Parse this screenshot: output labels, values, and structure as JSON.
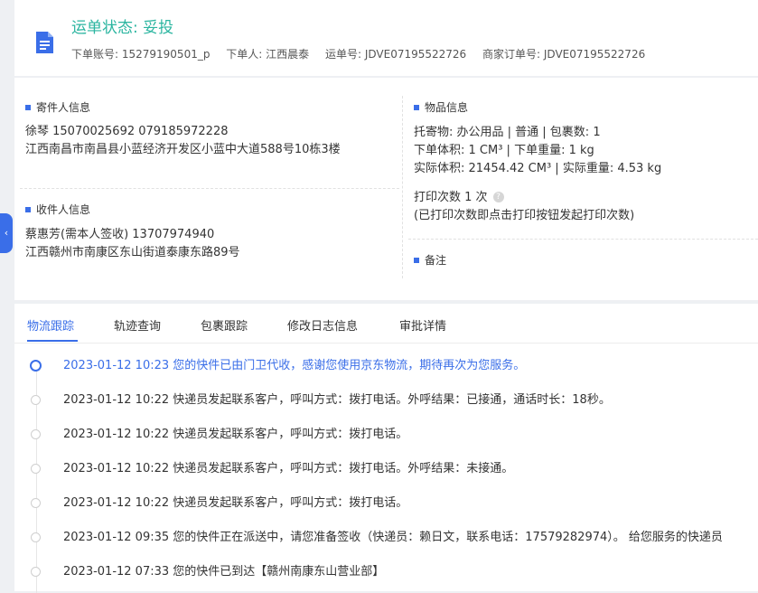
{
  "header": {
    "status": "运单状态: 妥投",
    "meta": [
      "下单账号: 15279190501_p",
      "下单人: 江西晨泰",
      "运单号: JDVE07195522726",
      "商家订单号: JDVE07195522726"
    ]
  },
  "sender": {
    "title": "寄件人信息",
    "line1": "徐琴  15070025692  079185972228",
    "line2": "江西南昌市南昌县小蓝经济开发区小蓝中大道588号10栋3楼"
  },
  "receiver": {
    "title": "收件人信息",
    "line1": "蔡惠芳(需本人签收)  13707974940",
    "line2": "江西赣州市南康区东山街道泰康东路89号"
  },
  "goods": {
    "title": "物品信息",
    "line1": "托寄物:  办公用品 | 普通 | 包裹数:  1",
    "line2": "下单体积:  1 CM³ | 下单重量:  1 kg",
    "line3": "实际体积:  21454.42 CM³ | 实际重量:  4.53 kg",
    "print_count": "打印次数   1 次",
    "print_note": "(已打印次数即点击打印按钮发起打印次数)"
  },
  "remark": {
    "title": "备注"
  },
  "side_tab_glyph": "‹",
  "tabs": [
    "物流跟踪",
    "轨迹查询",
    "包裹跟踪",
    "修改日志信息",
    "审批详情"
  ],
  "timeline": [
    "2023-01-12 10:23 您的快件已由门卫代收，感谢您使用京东物流，期待再次为您服务。",
    "2023-01-12 10:22 快递员发起联系客户，呼叫方式：拨打电话。外呼结果：已接通，通话时长：18秒。",
    "2023-01-12 10:22 快递员发起联系客户，呼叫方式：拨打电话。",
    "2023-01-12 10:22 快递员发起联系客户，呼叫方式：拨打电话。外呼结果：未接通。",
    "2023-01-12 10:22 快递员发起联系客户，呼叫方式：拨打电话。",
    "2023-01-12 09:35 您的快件正在派送中，请您准备签收（快递员：赖日文，联系电话：17579282974）。 给您服务的快递员",
    "2023-01-12 07:33 您的快件已到达【赣州南康东山营业部】"
  ],
  "colors": {
    "accent": "#3a6ee8",
    "status": "#2bb5a0"
  }
}
